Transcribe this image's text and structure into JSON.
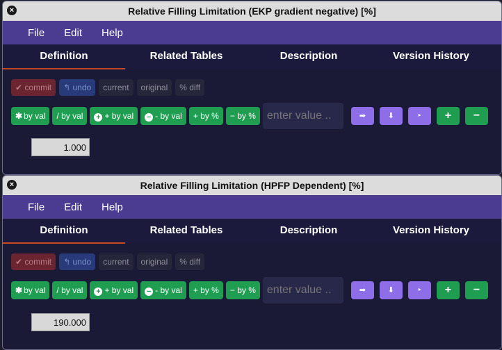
{
  "windows": [
    {
      "title": "Relative Filling Limitation (EKP gradient negative) [%]",
      "menu": [
        "File",
        "Edit",
        "Help"
      ],
      "tabs": [
        "Definition",
        "Related Tables",
        "Description",
        "Version History"
      ],
      "state_buttons": {
        "commit": "commit",
        "undo": "undo",
        "current": "current",
        "original": "original",
        "pct_diff": "% diff"
      },
      "ops": {
        "mul": "by val",
        "div": "/ by val",
        "add": "+ by val",
        "sub": "- by val",
        "add_pct": "+ by %",
        "sub_pct": "− by %"
      },
      "input_placeholder": "enter value ..",
      "value": "1.000"
    },
    {
      "title": "Relative Filling Limitation (HPFP Dependent) [%]",
      "menu": [
        "File",
        "Edit",
        "Help"
      ],
      "tabs": [
        "Definition",
        "Related Tables",
        "Description",
        "Version History"
      ],
      "state_buttons": {
        "commit": "commit",
        "undo": "undo",
        "current": "current",
        "original": "original",
        "pct_diff": "% diff"
      },
      "ops": {
        "mul": "by val",
        "div": "/ by val",
        "add": "+ by val",
        "sub": "- by val",
        "add_pct": "+ by %",
        "sub_pct": "− by %"
      },
      "input_placeholder": "enter value ..",
      "value": "190.000"
    }
  ]
}
